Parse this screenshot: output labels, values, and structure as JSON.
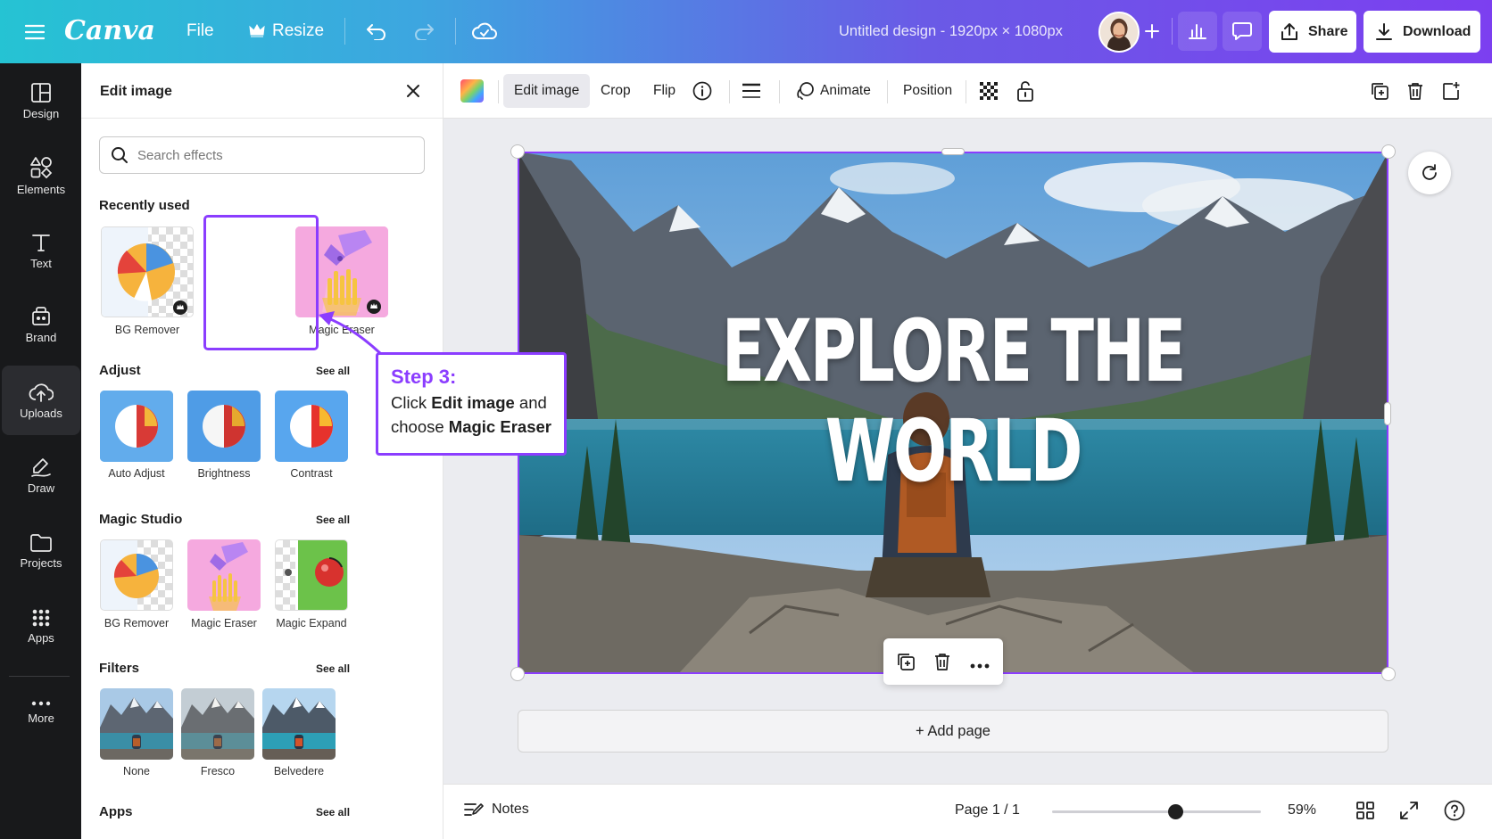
{
  "topbar": {
    "logo": "Canva",
    "file_label": "File",
    "resize_label": "Resize",
    "doc_title": "Untitled design - 1920px × 1080px",
    "share_label": "Share",
    "download_label": "Download"
  },
  "rail": {
    "items": [
      {
        "label": "Design",
        "icon": "layout-icon"
      },
      {
        "label": "Elements",
        "icon": "shapes-icon"
      },
      {
        "label": "Text",
        "icon": "text-t-icon"
      },
      {
        "label": "Brand",
        "icon": "brand-icon"
      },
      {
        "label": "Uploads",
        "icon": "cloud-upload-icon"
      },
      {
        "label": "Draw",
        "icon": "pen-icon"
      },
      {
        "label": "Projects",
        "icon": "folder-icon"
      },
      {
        "label": "Apps",
        "icon": "grid-dots-icon"
      },
      {
        "label": "More",
        "icon": "ellipsis-icon"
      }
    ],
    "active": "Uploads"
  },
  "panel": {
    "title": "Edit image",
    "search_placeholder": "Search effects",
    "recently_used": {
      "title": "Recently used",
      "items": [
        "BG Remover",
        "Magic Eraser"
      ]
    },
    "adjust": {
      "title": "Adjust",
      "see_all": "See all",
      "items": [
        "Auto Adjust",
        "Brightness",
        "Contrast"
      ]
    },
    "magic_studio": {
      "title": "Magic Studio",
      "see_all": "See all",
      "items": [
        "BG Remover",
        "Magic Eraser",
        "Magic Expand"
      ]
    },
    "filters": {
      "title": "Filters",
      "see_all": "See all",
      "items": [
        "None",
        "Fresco",
        "Belvedere"
      ]
    },
    "apps": {
      "title": "Apps",
      "see_all": "See all"
    }
  },
  "callout": {
    "step": "Step 3:",
    "line1_prefix": "Click ",
    "line1_bold": "Edit image",
    "line1_suffix": " and",
    "line2_prefix": "choose ",
    "line2_bold": "Magic Eraser"
  },
  "context_toolbar": {
    "edit_image": "Edit image",
    "crop": "Crop",
    "flip": "Flip",
    "animate": "Animate",
    "position": "Position"
  },
  "canvas": {
    "headline": "EXPLORE THE WORLD",
    "add_page": "+ Add page"
  },
  "bottombar": {
    "notes": "Notes",
    "page_indicator": "Page 1 / 1",
    "zoom": "59%",
    "zoom_level": 0.59
  },
  "colors": {
    "accent": "#8b3dff",
    "rail_bg": "#18191b",
    "workarea_bg": "#ebecf0"
  }
}
